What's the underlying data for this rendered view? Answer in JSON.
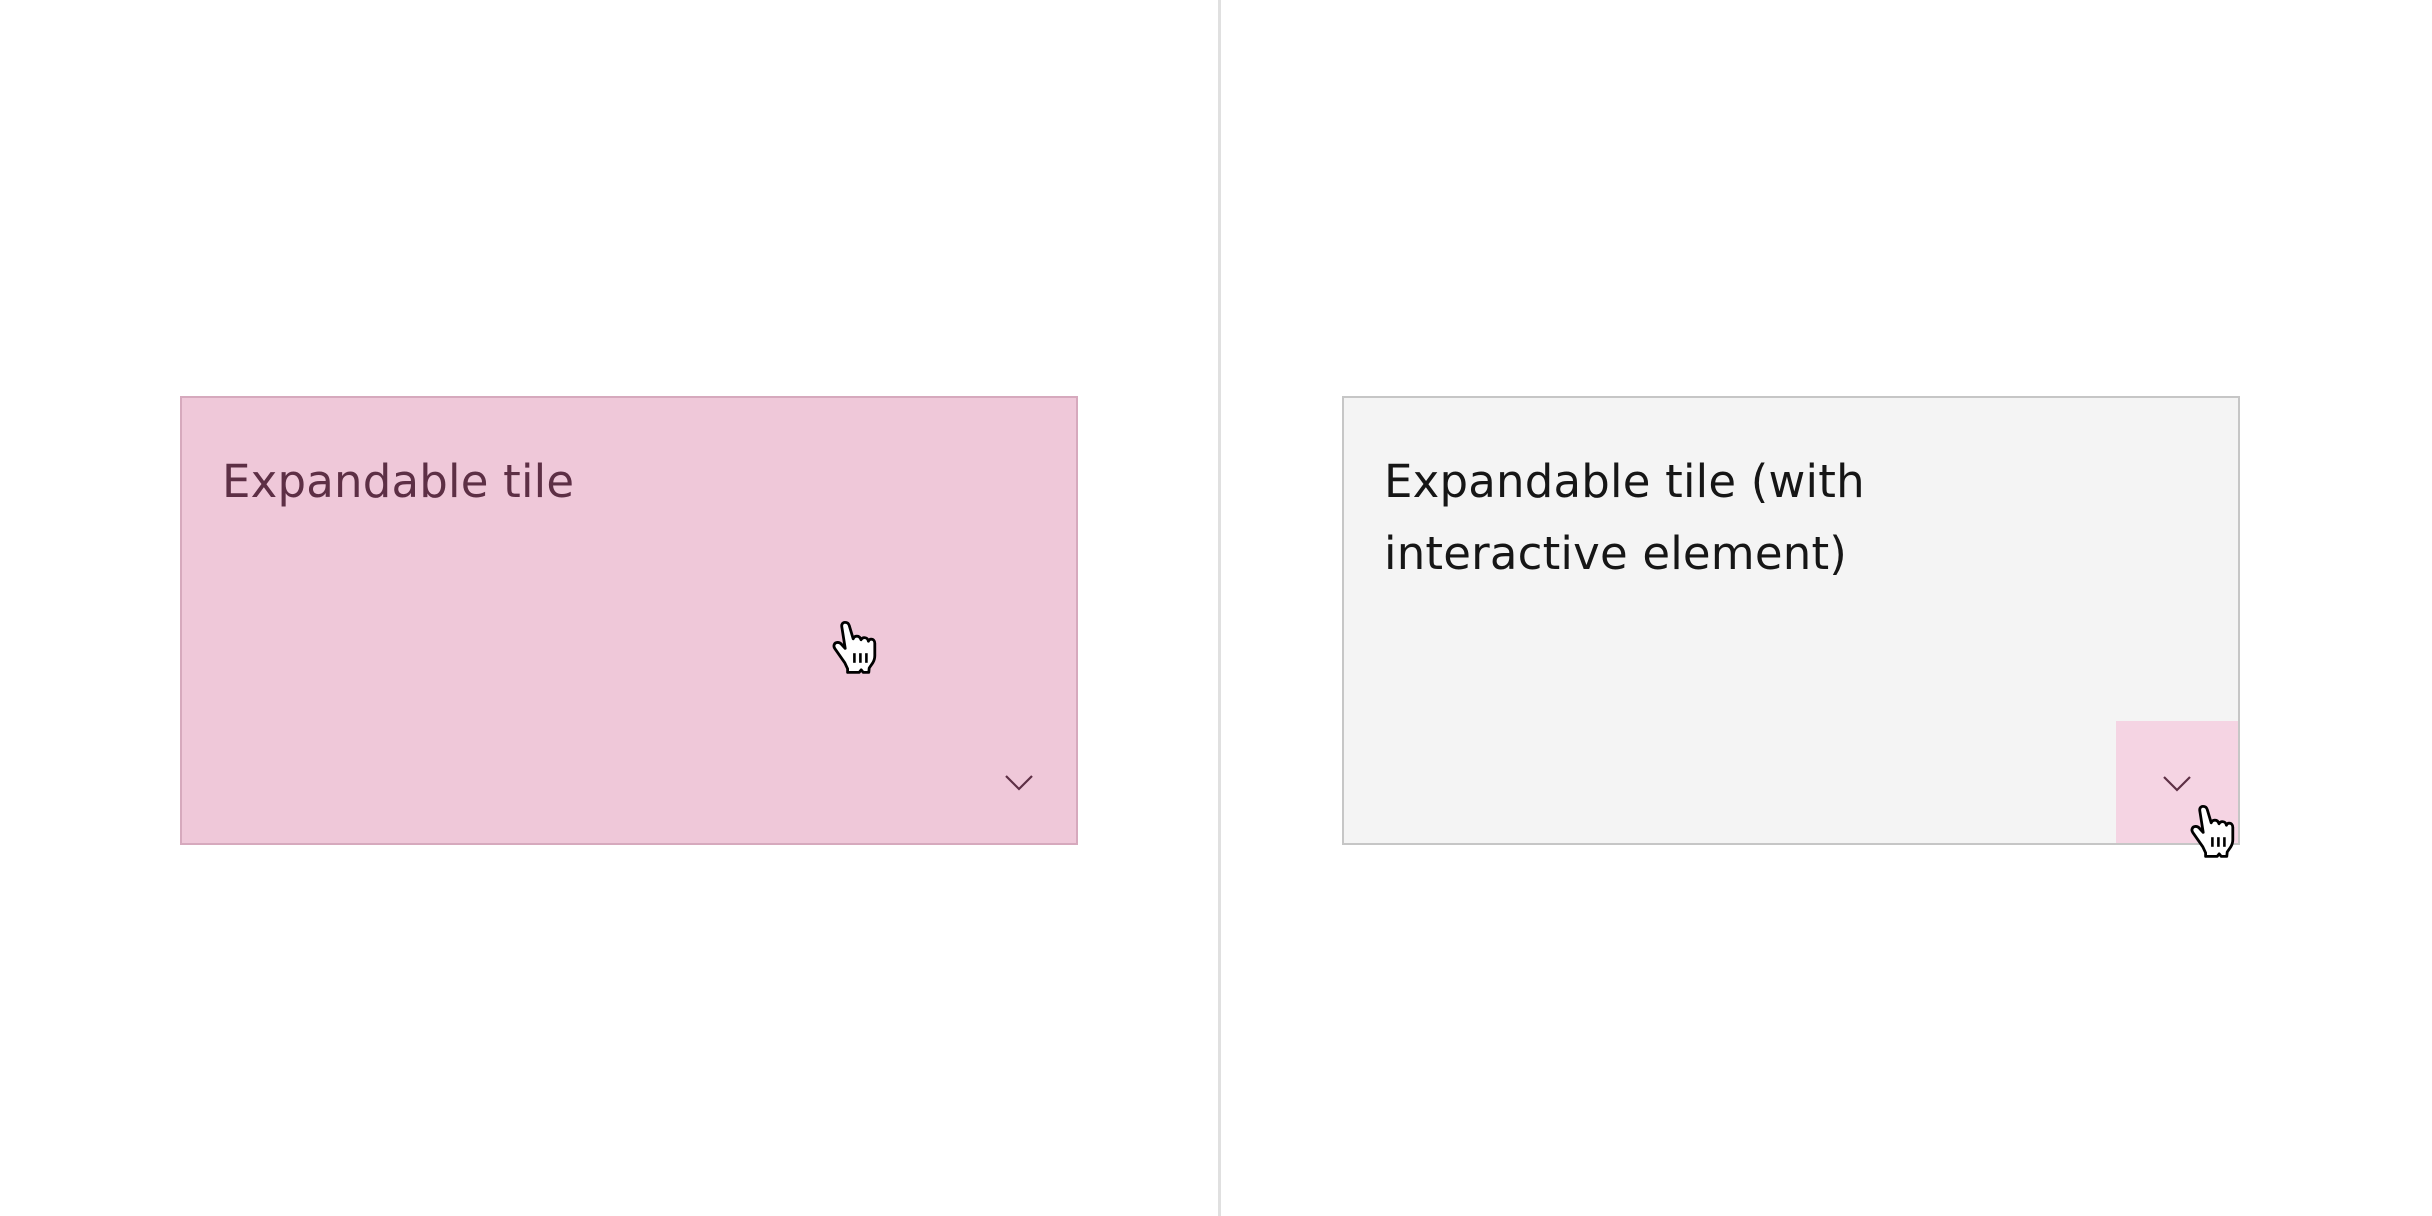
{
  "left_panel": {
    "tile_title": "Expandable tile",
    "chevron_icon": "chevron-down-icon",
    "cursor_icon": "hand-pointer-icon"
  },
  "right_panel": {
    "tile_title": "Expandable tile (with\ninteractive element)",
    "chevron_icon": "chevron-down-icon",
    "cursor_icon": "hand-pointer-icon"
  },
  "colors": {
    "left_tile_bg": "#efc8d9",
    "left_tile_border": "#d6a9bd",
    "left_text": "#5d2f45",
    "right_tile_bg": "#f4f4f4",
    "right_tile_border": "#c6c6c6",
    "right_text": "#161616",
    "expand_button_bg": "#f5d4e3",
    "divider": "#e0e0e0"
  }
}
